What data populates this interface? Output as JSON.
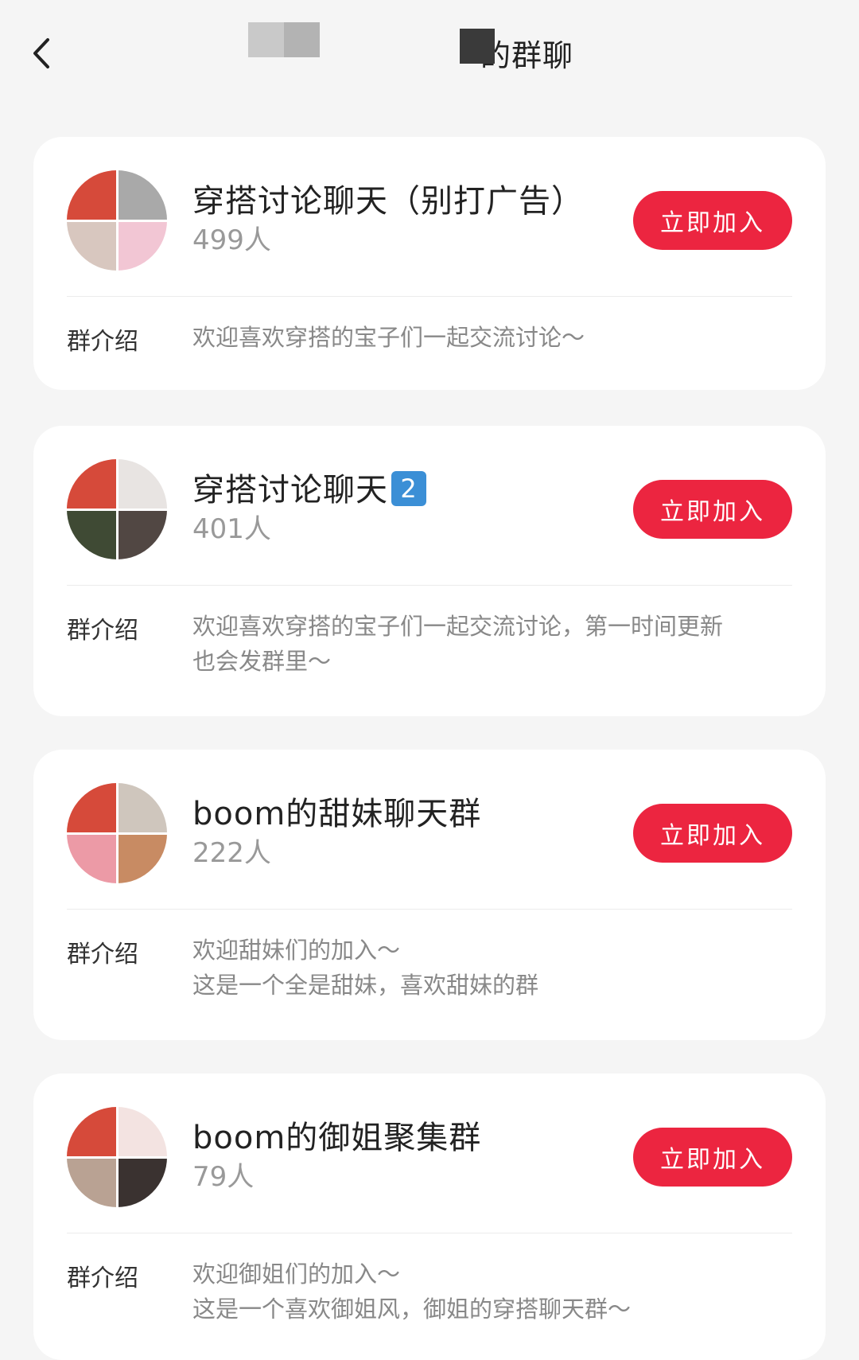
{
  "header": {
    "title": "的群聊"
  },
  "groups": [
    {
      "name": "穿搭讨论聊天（别打广告）",
      "members": "499人",
      "join_label": "立即加入",
      "intro_label": "群介绍",
      "intro": [
        "欢迎喜欢穿搭的宝子们一起交流讨论～"
      ]
    },
    {
      "name": "穿搭讨论聊天",
      "name_badge": "2",
      "members": "401人",
      "join_label": "立即加入",
      "intro_label": "群介绍",
      "intro": [
        "欢迎喜欢穿搭的宝子们一起交流讨论，第一时间更新",
        "也会发群里～"
      ]
    },
    {
      "name": "boom的甜妹聊天群",
      "members": "222人",
      "join_label": "立即加入",
      "intro_label": "群介绍",
      "intro": [
        "欢迎甜妹们的加入～",
        "这是一个全是甜妹，喜欢甜妹的群"
      ]
    },
    {
      "name": "boom的御姐聚集群",
      "members": "79人",
      "join_label": "立即加入",
      "intro_label": "群介绍",
      "intro": [
        "欢迎御姐们的加入～",
        "这是一个喜欢御姐风，御姐的穿搭聊天群～"
      ]
    }
  ],
  "colors": {
    "accent": "#ec2540",
    "background": "#f5f5f5"
  }
}
